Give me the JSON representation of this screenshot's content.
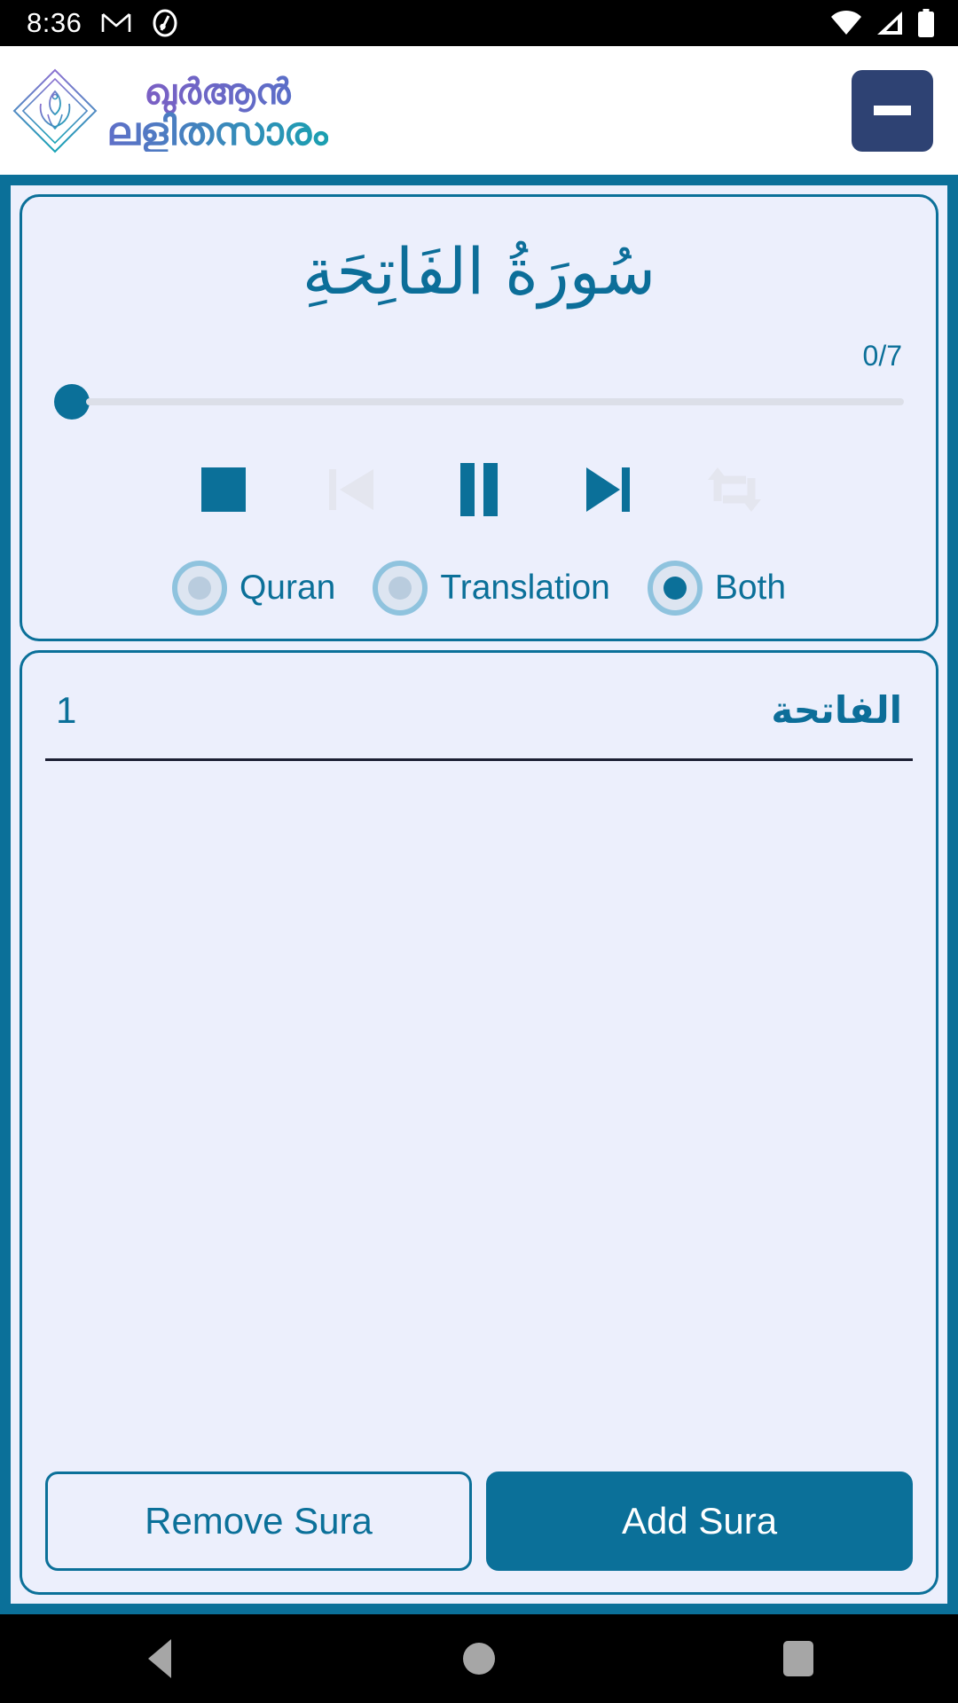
{
  "status_bar": {
    "clock": "8:36",
    "icons_left": [
      "gmail-icon",
      "app-notification-icon"
    ],
    "icons_right": [
      "wifi-icon",
      "cellular-signal-icon",
      "battery-icon"
    ]
  },
  "header": {
    "brand_line1": "ഖുർആൻ",
    "brand_line2": "ലളിതസാരം",
    "logo_name": "quran-diamond-logo",
    "minimize_label": "—",
    "minimize_icon": "minimize-icon",
    "brand_color_start": "#7b5fc4",
    "brand_color_end": "#19a0b0",
    "minimize_button_color": "#2e4273"
  },
  "player": {
    "sura_title_arabic": "سُورَةُ الفَاتِحَةِ",
    "progress_label": "0/7",
    "progress_value": 0,
    "progress_max": 7,
    "controls": [
      {
        "name": "stop-button",
        "icon": "stop-icon",
        "enabled": true
      },
      {
        "name": "previous-button",
        "icon": "skip-previous-icon",
        "enabled": false
      },
      {
        "name": "pause-button",
        "icon": "pause-icon",
        "enabled": true
      },
      {
        "name": "next-button",
        "icon": "skip-next-icon",
        "enabled": true
      },
      {
        "name": "repeat-button",
        "icon": "repeat-icon",
        "enabled": false
      }
    ],
    "modes": [
      {
        "label": "Quran",
        "selected": false
      },
      {
        "label": "Translation",
        "selected": false
      },
      {
        "label": "Both",
        "selected": true
      }
    ]
  },
  "sura_list": {
    "rows": [
      {
        "index": "1",
        "name_arabic": "الفاتحة"
      }
    ]
  },
  "actions": {
    "remove_label": "Remove Sura",
    "add_label": "Add Sura"
  },
  "nav_bar": {
    "back": "back-icon",
    "home": "home-icon",
    "recents": "recents-icon"
  },
  "colors": {
    "accent": "#0b7099",
    "panel_bg": "#eceffc",
    "frame_border": "#0b7099",
    "disabled": "#e4e6ef",
    "separator": "#1c1f33"
  }
}
